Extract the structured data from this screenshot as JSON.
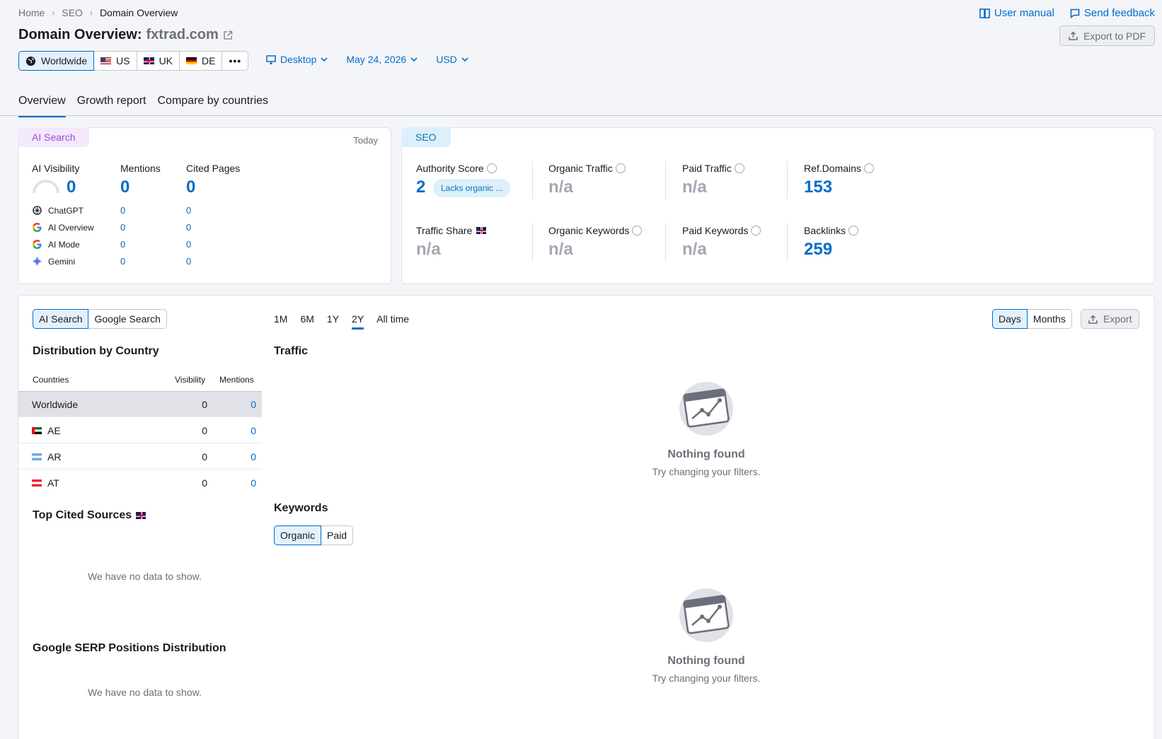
{
  "breadcrumb": [
    "Home",
    "SEO",
    "Domain Overview"
  ],
  "links": {
    "user_manual": "User manual",
    "send_feedback": "Send feedback"
  },
  "title": {
    "prefix": "Domain Overview:",
    "domain": "fxtrad.com"
  },
  "export_pdf": "Export to PDF",
  "regions": [
    "Worldwide",
    "US",
    "UK",
    "DE"
  ],
  "filters": {
    "device": "Desktop",
    "date": "May 24, 2026",
    "currency": "USD"
  },
  "tabs": [
    "Overview",
    "Growth report",
    "Compare by countries"
  ],
  "ai_card": {
    "pill": "AI Search",
    "today": "Today",
    "headers": [
      "AI Visibility",
      "Mentions",
      "Cited Pages"
    ],
    "totals": [
      "0",
      "0",
      "0"
    ],
    "visibility_gauge_value": 0,
    "rows": [
      {
        "icon": "chatgpt-icon",
        "name": "ChatGPT",
        "mentions": "0",
        "cited": "0"
      },
      {
        "icon": "google-icon",
        "name": "AI Overview",
        "mentions": "0",
        "cited": "0"
      },
      {
        "icon": "google-icon",
        "name": "AI Mode",
        "mentions": "0",
        "cited": "0"
      },
      {
        "icon": "gemini-icon",
        "name": "Gemini",
        "mentions": "0",
        "cited": "0"
      }
    ]
  },
  "seo_card": {
    "pill": "SEO",
    "authority_score": {
      "label": "Authority Score",
      "value": "2",
      "badge": "Lacks organic ..."
    },
    "organic_traffic": {
      "label": "Organic Traffic",
      "value": "n/a"
    },
    "paid_traffic": {
      "label": "Paid Traffic",
      "value": "n/a"
    },
    "ref_domains": {
      "label": "Ref.Domains",
      "value": "153"
    },
    "traffic_share": {
      "label": "Traffic Share",
      "value": "n/a"
    },
    "organic_keywords": {
      "label": "Organic Keywords",
      "value": "n/a"
    },
    "paid_keywords": {
      "label": "Paid Keywords",
      "value": "n/a"
    },
    "backlinks": {
      "label": "Backlinks",
      "value": "259"
    }
  },
  "main": {
    "search_toggle": [
      "AI Search",
      "Google Search"
    ],
    "distribution_title": "Distribution by Country",
    "table_headers": {
      "countries": "Countries",
      "visibility": "Visibility",
      "mentions": "Mentions"
    },
    "countries": [
      {
        "name": "Worldwide",
        "visibility": "0",
        "mentions": "0"
      },
      {
        "name": "AE",
        "visibility": "0",
        "mentions": "0"
      },
      {
        "name": "AR",
        "visibility": "0",
        "mentions": "0"
      },
      {
        "name": "AT",
        "visibility": "0",
        "mentions": "0"
      }
    ],
    "top_cited_title": "Top Cited Sources",
    "no_data": "We have no data to show.",
    "serp_title": "Google SERP Positions Distribution",
    "ranges": [
      "1M",
      "6M",
      "1Y",
      "2Y",
      "All time"
    ],
    "active_range": "2Y",
    "granularity": [
      "Days",
      "Months"
    ],
    "export": "Export",
    "traffic_title": "Traffic",
    "keywords_title": "Keywords",
    "keyword_toggle": [
      "Organic",
      "Paid"
    ],
    "empty_title": "Nothing found",
    "empty_sub": "Try changing your filters."
  },
  "colors": {
    "accent": "#006dca",
    "ai_pill": "#f3e8fc",
    "seo_pill": "#dcf0fb",
    "muted": "#a4a7b2"
  }
}
